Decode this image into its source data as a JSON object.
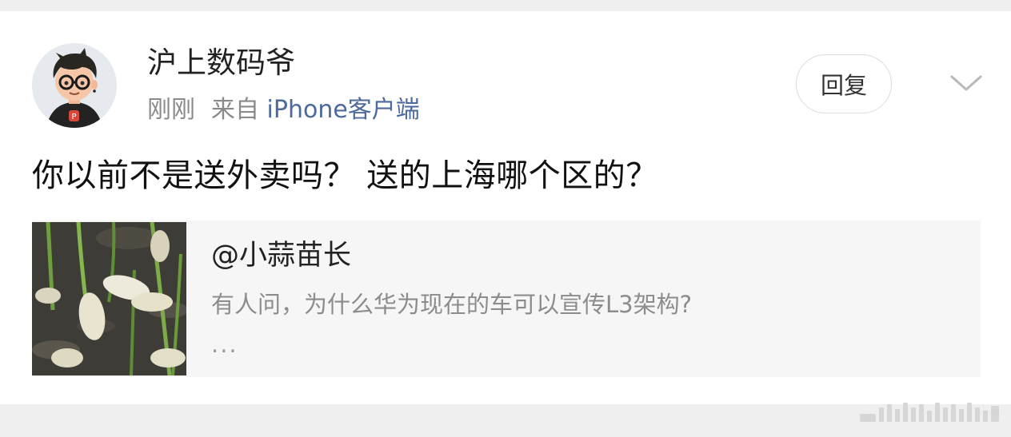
{
  "comment": {
    "username": "沪上数码爷",
    "time": "刚刚",
    "from_label": "来自",
    "source": "iPhone客户端",
    "reply_label": "回复",
    "text": "你以前不是送外卖吗？ 送的上海哪个区的？"
  },
  "quoted": {
    "author": "@小蒜苗长",
    "text": "有人问，为什么华为现在的车可以宣传L3架构?",
    "ellipsis": "..."
  },
  "colors": {
    "source_link": "#4c6a9c",
    "background": "#efefef",
    "quote_bg": "#f6f6f6"
  },
  "icons": {
    "expand": "chevron-down-icon",
    "watermark": "watermark-stripes-icon"
  }
}
